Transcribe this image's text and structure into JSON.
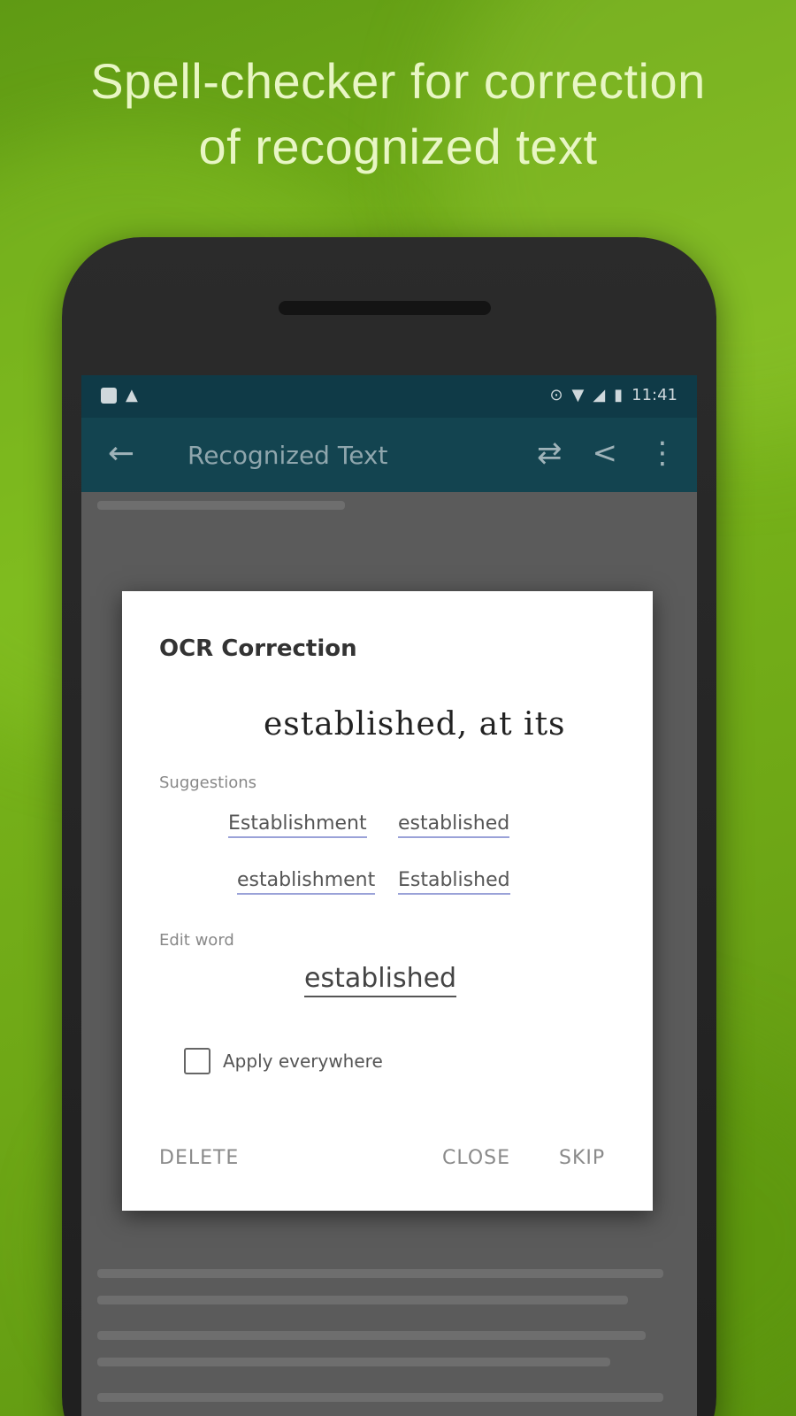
{
  "headline": {
    "line1": "Spell-checker for correction",
    "line2": "of recognized text"
  },
  "status_bar": {
    "time": "11:41"
  },
  "app_bar": {
    "back_icon": "←",
    "title": "Recognized Text",
    "action_icons": [
      "sync-icon",
      "share-icon",
      "more-vert-icon"
    ]
  },
  "dialog": {
    "title": "OCR Correction",
    "ocr_word": "established, at its",
    "suggestions_label": "Suggestions",
    "suggestions": [
      "Establishment",
      "established",
      "establishment",
      "Established"
    ],
    "edit_label": "Edit word",
    "edit_value": "established",
    "checkbox_label": "Apply everywhere",
    "buttons": {
      "left": "DELETE",
      "middle": "CLOSE",
      "right": "SKIP"
    }
  }
}
